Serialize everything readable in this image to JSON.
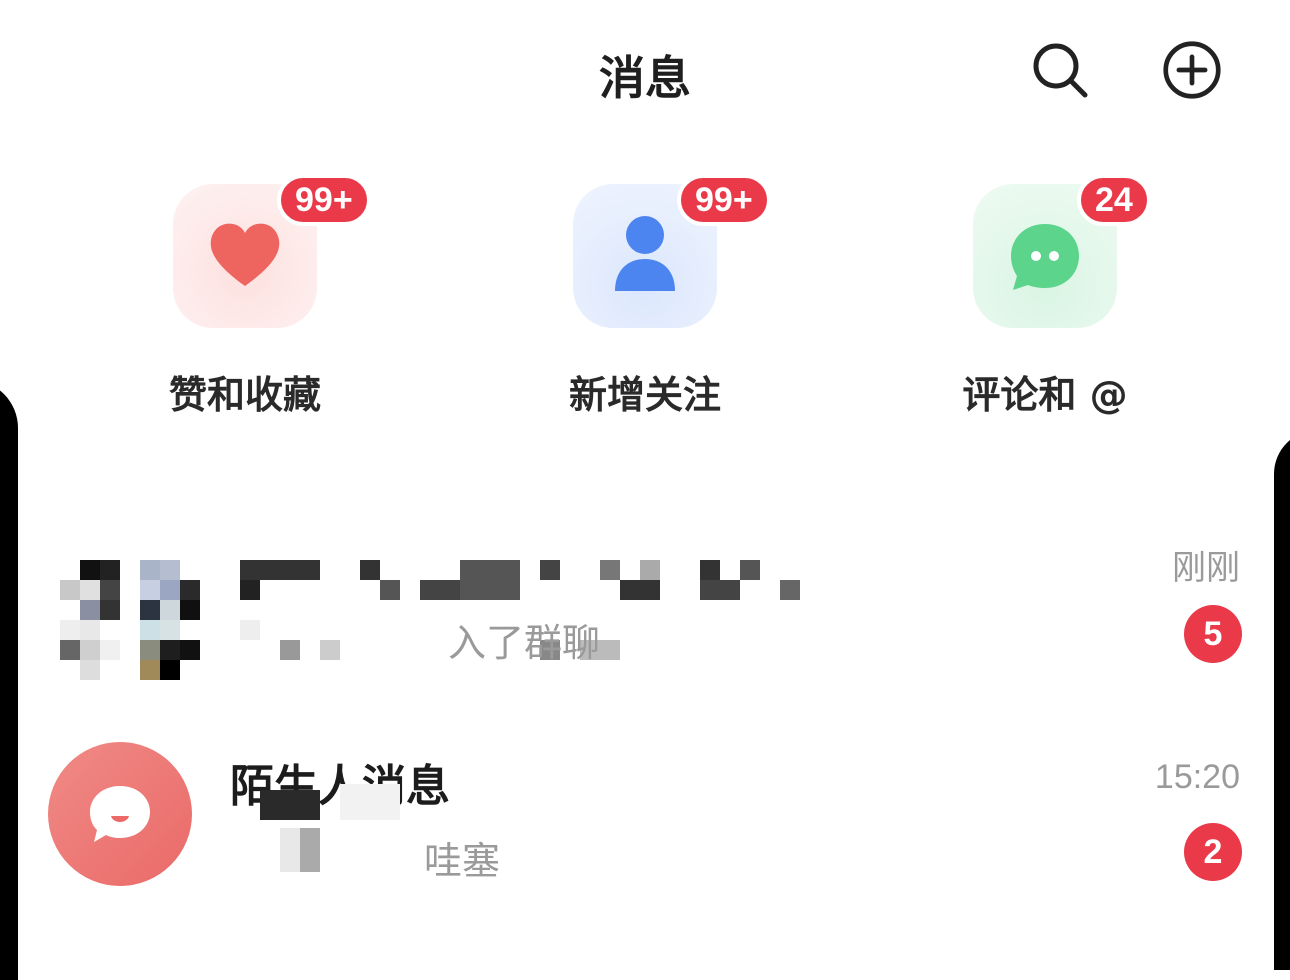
{
  "header": {
    "title": "消息",
    "search_icon": "search-icon",
    "add_icon": "add-circle-icon"
  },
  "categories": [
    {
      "label": "赞和收藏",
      "badge": "99+",
      "icon": "heart-icon",
      "color": "#ee6560"
    },
    {
      "label": "新增关注",
      "badge": "99+",
      "icon": "person-icon",
      "color": "#4d85f0"
    },
    {
      "label": "评论和 @",
      "badge": "24",
      "icon": "chat-bubble-icon",
      "color": "#5dd48c"
    }
  ],
  "messages": [
    {
      "preview": "入了群聊",
      "time": "刚刚",
      "unread": "5"
    },
    {
      "name": "陌生人消息",
      "preview": "哇塞",
      "time": "15:20",
      "unread": "2",
      "avatar_color": "#ec7370"
    }
  ],
  "colors": {
    "badge": "#ea3a4a",
    "title": "#1f1f1f",
    "secondary_text": "#9a9a9a"
  }
}
